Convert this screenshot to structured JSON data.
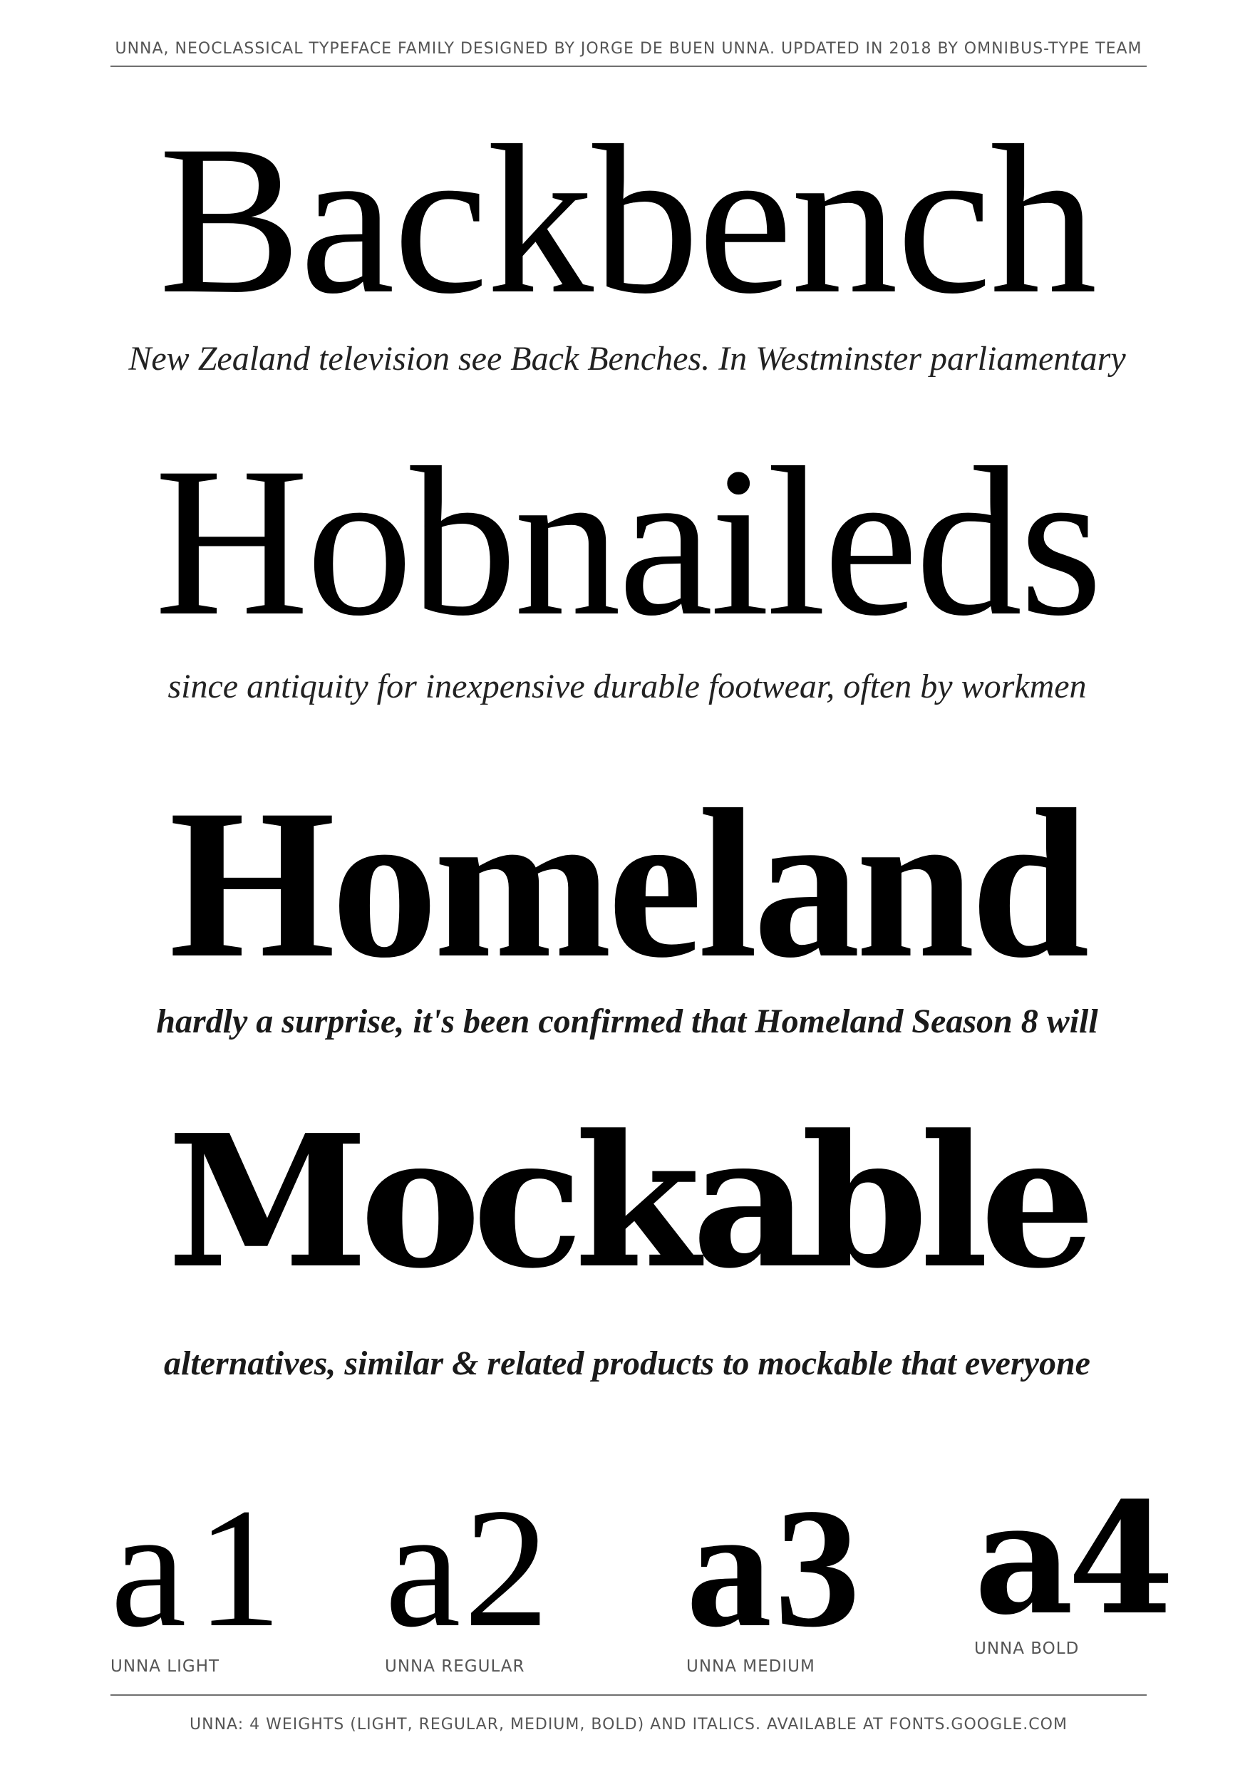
{
  "header": {
    "text": "UNNA, NEOCLASSICAL TYPEFACE FAMILY DESIGNED BY JORGE DE BUEN UNNA. UPDATED IN 2018 BY OMNIBUS-TYPE TEAM"
  },
  "specimens": [
    {
      "word": "Backbench",
      "caption": "New Zealand television see Back Benches. In Westminster parliamentary"
    },
    {
      "word": "Hobnaileds",
      "caption": "since antiquity for inexpensive durable footwear, often by workmen"
    },
    {
      "word": "Homeland",
      "caption": "hardly a surprise, it's been confirmed that Homeland Season 8 will"
    },
    {
      "word": "Mockable",
      "caption": "alternatives, similar & related products to mockable that everyone"
    }
  ],
  "weights": [
    {
      "glyph": "a1",
      "label": "UNNA LIGHT"
    },
    {
      "glyph": "a2",
      "label": "UNNA REGULAR"
    },
    {
      "glyph": "a3",
      "label": "UNNA MEDIUM"
    },
    {
      "glyph": "a4",
      "label": "UNNA BOLD"
    }
  ],
  "footer": {
    "text": "UNNA: 4 WEIGHTS (LIGHT, REGULAR, MEDIUM, BOLD) AND ITALICS. AVAILABLE AT FONTS.GOOGLE.COM"
  }
}
